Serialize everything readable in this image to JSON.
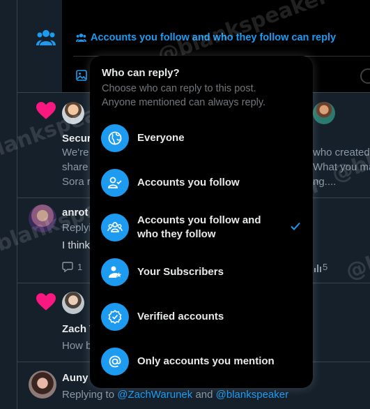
{
  "composer": {
    "reply_setting": "Accounts you follow and who they follow can reply"
  },
  "reply_menu": {
    "title": "Who can reply?",
    "description": "Choose who can reply to this post. Anyone mentioned can always reply.",
    "options": [
      {
        "label": "Everyone",
        "icon": "globe-icon",
        "selected": false
      },
      {
        "label": "Accounts you follow",
        "icon": "person-check-icon",
        "selected": false
      },
      {
        "label": "Accounts you follow and who they follow",
        "icon": "people-icon",
        "selected": true
      },
      {
        "label": "Your Subscribers",
        "icon": "person-star-icon",
        "selected": false
      },
      {
        "label": "Verified accounts",
        "icon": "verified-badge-icon",
        "selected": false
      },
      {
        "label": "Only accounts you mention",
        "icon": "at-sign-icon",
        "selected": false
      }
    ]
  },
  "timeline": {
    "post1": {
      "name": "Secur",
      "text_lines": [
        "We're",
        "share",
        "Sora r"
      ],
      "right_lines": [
        "who created t",
        "What you ma",
        "ng...."
      ]
    },
    "post2": {
      "name": "anrot",
      "replying": "Replyi",
      "text": "I think",
      "reply_count": "1",
      "view_count": "5"
    },
    "post3": {
      "name": "Zach V",
      "text": "How b"
    },
    "post4": {
      "name": "Auny",
      "replying_prefix": "Replying to",
      "mention1": "@ZachWarunek",
      "and_word": "and",
      "mention2": "@blankspeaker"
    }
  },
  "watermark": "@blankspeaker",
  "colors": {
    "accent": "#1d9bf0",
    "background": "#15202b",
    "menu": "#000000",
    "heart": "#f91880"
  }
}
